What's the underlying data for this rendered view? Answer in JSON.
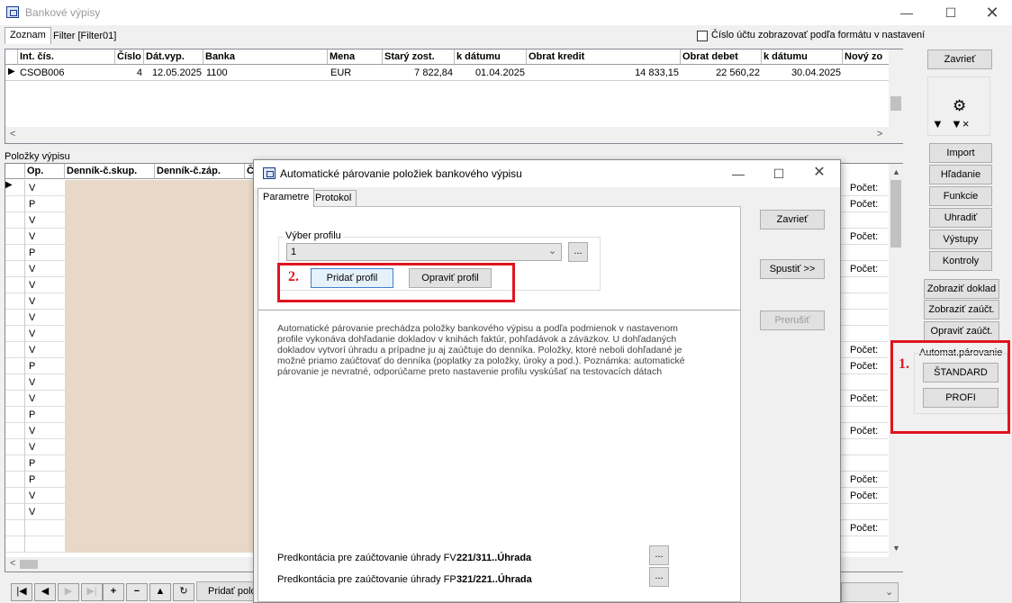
{
  "window": {
    "title": "Bankové výpisy"
  },
  "tabs": [
    "Zoznam",
    "Filter [Filter01]"
  ],
  "checkbox_label": "Číslo účtu zobrazovať podľa formátu v nastavení",
  "top_grid": {
    "columns": [
      "Int. čís.",
      "Číslo",
      "Dát.vyp.",
      "Banka",
      "Mena",
      "Starý zost.",
      "k dátumu",
      "Obrat kredit",
      "Obrat debet",
      "k dátumu",
      "Nový zo"
    ],
    "rows": [
      [
        "CSOB006",
        "4",
        "12.05.2025",
        "1100",
        "EUR",
        "7 822,84",
        "01.04.2025",
        "14 833,15",
        "22 560,22",
        "30.04.2025",
        ""
      ]
    ]
  },
  "items_section": {
    "title": "Položky výpisu",
    "columns": [
      "Op.",
      "Denník-č.skup.",
      "Denník-č.záp.",
      "Č"
    ],
    "op_values": [
      "V",
      "P",
      "V",
      "V",
      "P",
      "V",
      "V",
      "V",
      "V",
      "V",
      "V",
      "P",
      "V",
      "V",
      "P",
      "V",
      "V",
      "P",
      "P",
      "V",
      "V"
    ],
    "right_labels": [
      "Počet:",
      "Počet:",
      "",
      "Počet:",
      "",
      "Počet:",
      "",
      "",
      "",
      "",
      "Počet:",
      "Počet:",
      "",
      "Počet:",
      "",
      "Počet:",
      "",
      "",
      "Počet:",
      "Počet:",
      "",
      "Počet:"
    ]
  },
  "right_panel": {
    "close": "Zavrieť",
    "buttons": [
      "Import",
      "Hľadanie",
      "Funkcie",
      "Uhradiť",
      "Výstupy",
      "Kontroly"
    ],
    "buttons2": [
      "Zobraziť doklad",
      "Zobraziť zaúčt.",
      "Opraviť zaúčt."
    ],
    "group_title": "Automat.párovanie",
    "standard": "ŠTANDARD",
    "profi": "PROFI"
  },
  "annotations": {
    "one": "1.",
    "two": "2."
  },
  "bottom": {
    "add_button": "Pridať polo"
  },
  "dialog": {
    "title": "Automatické párovanie položiek bankového výpisu",
    "tabs": [
      "Parametre",
      "Protokol"
    ],
    "profile_group": "Výber profilu",
    "profile_value": "1",
    "browse": "...",
    "add_profile": "Pridať profil",
    "edit_profile": "Opraviť profil",
    "close": "Zavrieť",
    "run": "Spustiť >>",
    "stop": "Prerušiť",
    "description": "Automatické párovanie prechádza položky bankového výpisu a podľa podmienok v nastavenom profile vykonáva dohľadanie dokladov v knihách faktúr, pohľadávok a záväzkov. U dohľadaných dokladov vytvorí úhradu a prípadne ju aj zaúčtuje do denníka. Položky, ktoré neboli dohľadané je možné priamo zaúčtovať do denníka (poplatky za položky, úroky a pod.). Poznámka: automatické párovanie je nevratné, odporúčame preto nastavenie profilu vyskúšať na testovacích dátach",
    "predkont_fv_label": "Predkontácia pre zaúčtovanie úhrady FV",
    "predkont_fv_value": "221/311..Úhrada",
    "predkont_fp_label": "Predkontácia pre zaúčtovanie úhrady FP",
    "predkont_fp_value": "321/221..Úhrada"
  }
}
